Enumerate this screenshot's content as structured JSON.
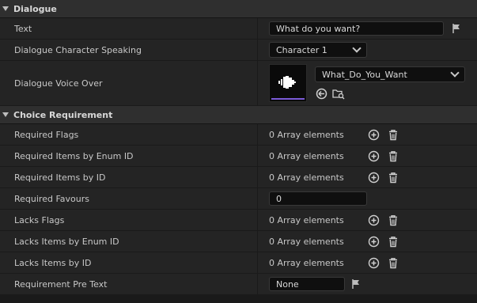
{
  "dialogue": {
    "header": "Dialogue",
    "text_label": "Text",
    "text_value": "What do you want?",
    "speaker_label": "Dialogue Character Speaking",
    "speaker_value": "Character 1",
    "voice_label": "Dialogue Voice Over",
    "voice_value": "What_Do_You_Want"
  },
  "choice": {
    "header": "Choice Requirement",
    "rows": [
      {
        "label": "Required Flags",
        "value": "0 Array elements"
      },
      {
        "label": "Required Items by Enum ID",
        "value": "0 Array elements"
      },
      {
        "label": "Required Items by ID",
        "value": "0 Array elements"
      },
      {
        "label": "Required Favours",
        "value": "0"
      },
      {
        "label": "Lacks Flags",
        "value": "0 Array elements"
      },
      {
        "label": "Lacks Items by Enum ID",
        "value": "0 Array elements"
      },
      {
        "label": "Lacks Items by ID",
        "value": "0 Array elements"
      },
      {
        "label": "Requirement Pre Text",
        "value": "None"
      }
    ]
  },
  "icons": {
    "flag": "flag-icon",
    "add": "add-circle-icon",
    "delete": "trash-icon",
    "use_selected": "arrow-left-circle-icon",
    "browse": "folder-search-icon",
    "audio": "audio-waveform-icon"
  },
  "colors": {
    "accent_bar": "#7a5ad8"
  }
}
